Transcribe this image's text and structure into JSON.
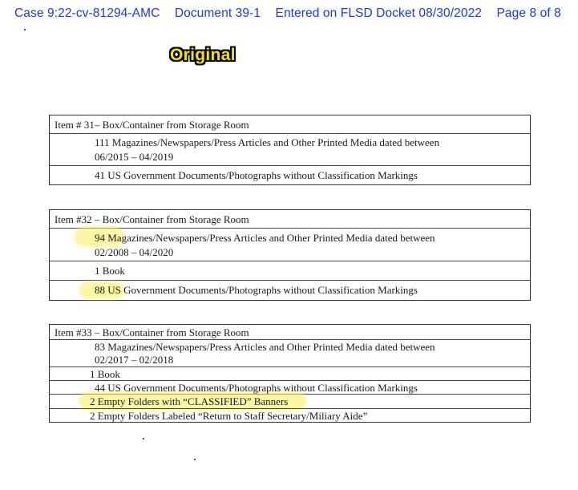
{
  "header": {
    "case": "Case 9:22-cv-81294-AMC",
    "document": "Document 39-1",
    "entered": "Entered on FLSD Docket 08/30/2022",
    "page": "Page 8 of 8"
  },
  "badge": "Original",
  "items": [
    {
      "title": "Item # 31– Box/Container from Storage Room",
      "rows": [
        [
          "111 Magazines/Newspapers/Press Articles and Other Printed Media dated between",
          "06/2015 – 04/2019"
        ],
        [
          "41 US Government Documents/Photographs without Classification Markings"
        ]
      ]
    },
    {
      "title": "Item #32 – Box/Container from Storage Room",
      "rows": [
        [
          "94 Magazines/Newspapers/Press Articles and Other Printed Media dated between",
          "02/2008 – 04/2020"
        ],
        [
          "1 Book"
        ],
        [
          "88 US Government Documents/Photographs without Classification Markings"
        ]
      ]
    },
    {
      "title": "Item #33 – Box/Container from Storage Room",
      "rows": [
        [
          "83 Magazines/Newspapers/Press Articles and Other Printed Media dated between",
          "02/2017 – 02/2018"
        ],
        [
          "1 Book"
        ],
        [
          "44 US Government Documents/Photographs without Classification Markings"
        ],
        [
          "2 Empty Folders with “CLASSIFIED” Banners"
        ],
        [
          "2 Empty Folders Labeled “Return to Staff Secretary/Miliary Aide”"
        ]
      ]
    }
  ],
  "colors": {
    "header": "#1f3bd6",
    "badge_fill": "#f5e300",
    "highlight": "#faf05a"
  }
}
